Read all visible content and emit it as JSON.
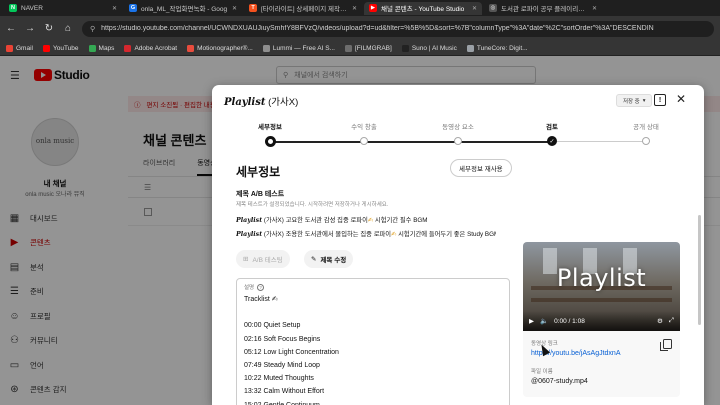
{
  "browser": {
    "tabs": [
      {
        "label": "NAVER",
        "color": "#03c75a",
        "glyph": "N",
        "active": false
      },
      {
        "label": "onla_ML_작업화면녹화 - Goog",
        "color": "#1a73e8",
        "glyph": "G",
        "active": false
      },
      {
        "label": "[타이라이트] 상세페이지 제작 콘텐",
        "color": "#f4511e",
        "glyph": "T",
        "active": false
      },
      {
        "label": "채널 콘텐츠 - YouTube Studio",
        "color": "#ff0000",
        "glyph": "▶",
        "active": true
      },
      {
        "label": "도서관 로파이 공부 플레이리스트",
        "color": "#555555",
        "glyph": "◎",
        "active": false
      }
    ],
    "url": "https://studio.youtube.com/channel/UCWNDXUAUJiuySmhfY8BFVzQ/videos/upload?d=ud&filter=%5B%5D&sort=%7B\"columnType\"%3A\"date\"%2C\"sortOrder\"%3A\"DESCENDIN",
    "bookmarks": [
      {
        "label": "Gmail",
        "color": "#ea4335"
      },
      {
        "label": "YouTube",
        "color": "#ff0000"
      },
      {
        "label": "Maps",
        "color": "#34a853"
      },
      {
        "label": "Adobe Acrobat",
        "color": "#d4272e"
      },
      {
        "label": "Motionographer®...",
        "color": "#e84c3d"
      },
      {
        "label": "Lummi — Free AI S...",
        "color": "#8e8e8e"
      },
      {
        "label": "[FILMGRAB]",
        "color": "#6d6d6d"
      },
      {
        "label": "Suno | AI Music",
        "color": "#222222"
      },
      {
        "label": "TuneCore: Digit...",
        "color": "#9aa0a6"
      }
    ]
  },
  "studio": {
    "logo_text": "Studio",
    "search_placeholder": "채널에서 검색하기",
    "banner": "편지 소진됨 · 편집한 내용이 영상에 올라가지 않도록 ...",
    "channel_label": "내 채널",
    "channel_name": "onla music 오나라 뮤직",
    "avatar_text": "onla music",
    "nav": [
      {
        "label": "대시보드",
        "icon": "▦",
        "name": "dashboard",
        "active": false
      },
      {
        "label": "콘텐츠",
        "icon": "▶",
        "name": "content",
        "active": true
      },
      {
        "label": "분석",
        "icon": "▤",
        "name": "analytics",
        "active": false
      },
      {
        "label": "준비",
        "icon": "☰",
        "name": "prep",
        "active": false
      },
      {
        "label": "프로필",
        "icon": "☺",
        "name": "profile",
        "active": false
      },
      {
        "label": "커뮤니티",
        "icon": "⚇",
        "name": "community",
        "active": false
      },
      {
        "label": "언어",
        "icon": "▭",
        "name": "language",
        "active": false
      },
      {
        "label": "콘텐츠 감지",
        "icon": "⊛",
        "name": "content-detection",
        "active": false
      }
    ],
    "page_title": "채널 콘텐츠",
    "content_tabs": [
      "라이브러리",
      "동영상"
    ]
  },
  "dialog": {
    "title_main": "Playlist",
    "title_sub": " (가사X)",
    "save_chip": "저장 중",
    "steps": [
      {
        "label": "세부정보",
        "state": "current"
      },
      {
        "label": "수익 창출",
        "state": "pending"
      },
      {
        "label": "동영상 요소",
        "state": "pending"
      },
      {
        "label": "검토",
        "state": "done"
      },
      {
        "label": "공개 상태",
        "state": "pending"
      }
    ],
    "section_title": "세부정보",
    "reuse_button": "세부정보 재사용",
    "ab_title": "제목 A/B 테스트",
    "ab_desc": "제목 테스트가 설정되었습니다. 시작하려면 저장하거나 게시하세요.",
    "ab_variants": [
      {
        "italic": "Playlist",
        "text": " (가사X) 고요한 도서관 감성 집중 로파이",
        "pencil": "✍",
        "tail": " 시험기간 필수 BGM"
      },
      {
        "italic": "Playlist",
        "text": " (가사X) 조용한 도서관에서 몰입하는 집중 로파이",
        "pencil": "✍",
        "tail": " 시험기간에 들어두기 좋은 Study BGM"
      }
    ],
    "ab_test_button": "A/B 테스팅",
    "edit_title_button": "제목 수정",
    "description_label": "설명",
    "description_lines": [
      "Tracklist ✍",
      "",
      "00:00 Quiet Setup",
      "02:16 Soft Focus Begins",
      "05:12 Low Light Concentration",
      "07:49 Steady Mind Loop",
      "10:22 Muted Thoughts",
      "13:32 Calm Without Effort",
      "15:02 Gentle Continuum"
    ],
    "preview": {
      "thumb_text": "Playlist",
      "time": "0:00 / 1:08",
      "link_label": "동영상 링크",
      "link": "https://youtu.be/jAsAgJtdxnA",
      "file_label": "파일 이름",
      "file_name": "@0607-study.mp4"
    }
  }
}
